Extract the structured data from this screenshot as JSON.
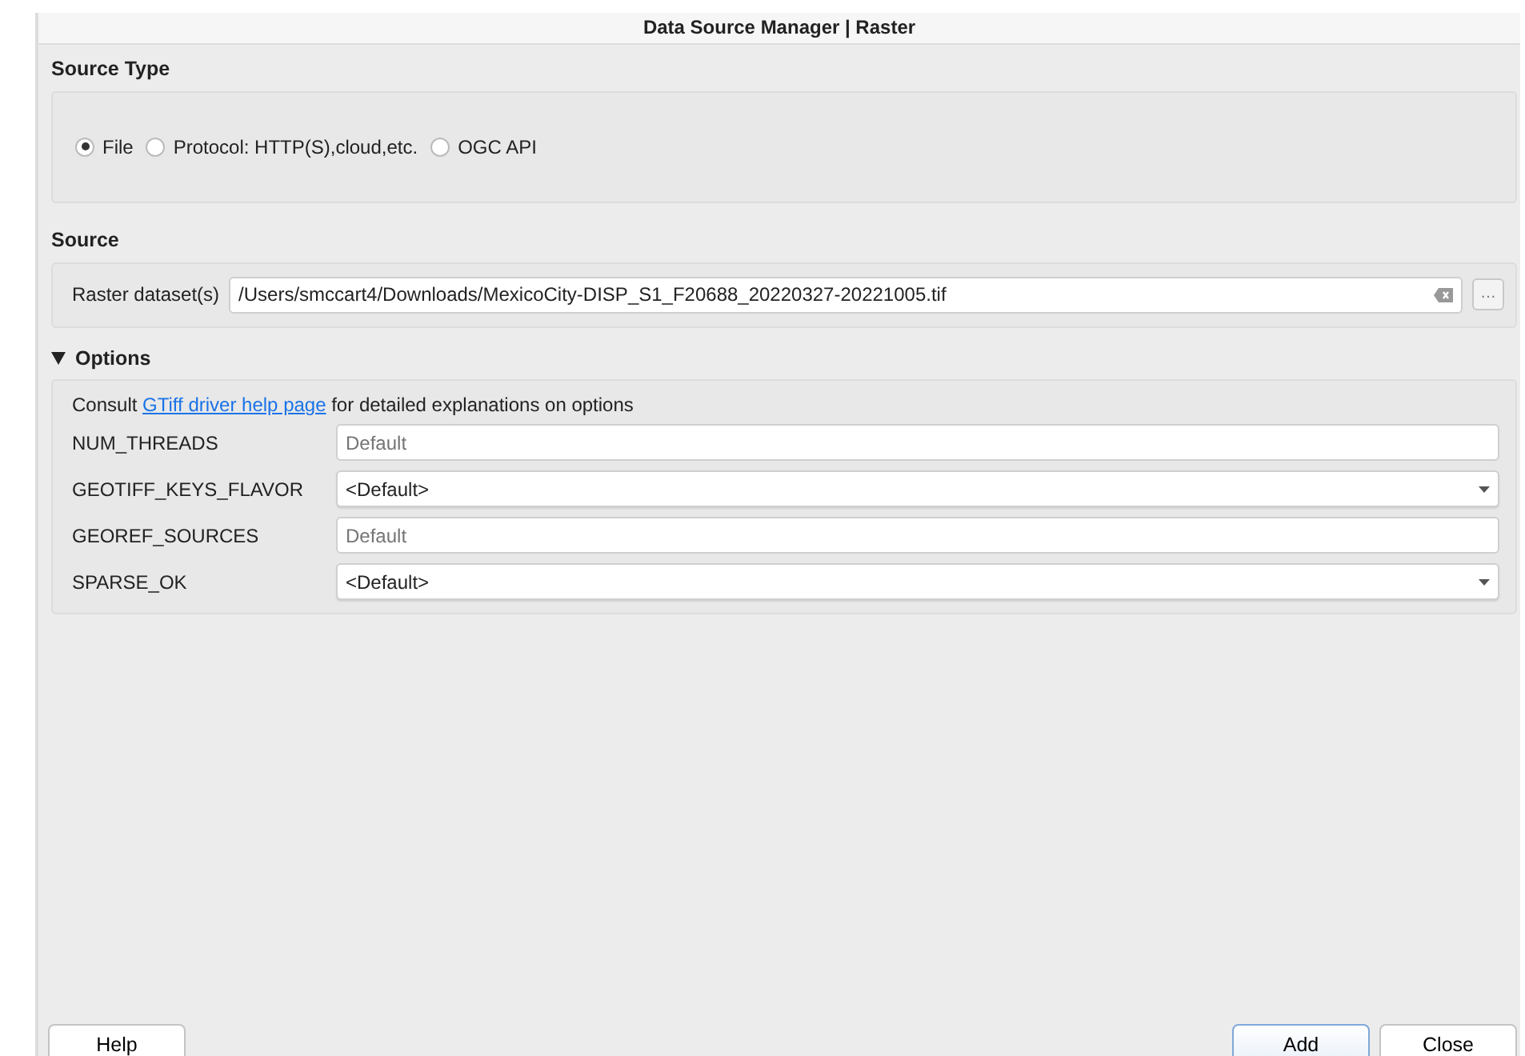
{
  "window": {
    "title": "Data Source Manager | Raster"
  },
  "source_type": {
    "title": "Source Type",
    "options": [
      {
        "label": "File",
        "selected": true
      },
      {
        "label": "Protocol: HTTP(S),cloud,etc.",
        "selected": false
      },
      {
        "label": "OGC API",
        "selected": false
      }
    ]
  },
  "source": {
    "title": "Source",
    "label": "Raster dataset(s)",
    "value": "/Users/smccart4/Downloads/MexicoCity-DISP_S1_F20688_20220327-20221005.tif",
    "browse": "…"
  },
  "options": {
    "title": "Options",
    "expanded": true,
    "intro": {
      "before": "Consult ",
      "link": "GTiff driver help page",
      "after": " for detailed explanations on options"
    },
    "rows": [
      {
        "label": "NUM_THREADS",
        "kind": "text",
        "placeholder": "Default"
      },
      {
        "label": "GEOTIFF_KEYS_FLAVOR",
        "kind": "select",
        "value": "<Default>"
      },
      {
        "label": "GEOREF_SOURCES",
        "kind": "text",
        "placeholder": "Default"
      },
      {
        "label": "SPARSE_OK",
        "kind": "select",
        "value": "<Default>"
      }
    ]
  },
  "buttons_left": [
    {
      "label": "Help",
      "default": false
    }
  ],
  "buttons_right": [
    {
      "label": "Add",
      "default": true
    },
    {
      "label": "Close",
      "default": false
    }
  ]
}
